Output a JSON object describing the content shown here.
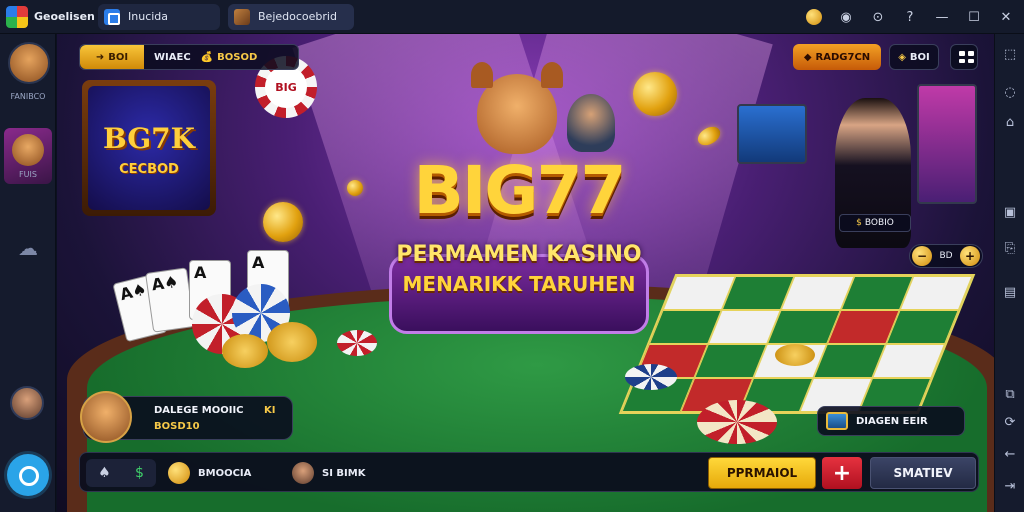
{
  "titlebar": {
    "app_title": "Geoelisen",
    "tabs": [
      {
        "label": "Inucida",
        "icon": "home-icon"
      },
      {
        "label": "Bejedocoebrid",
        "icon": "game-thumbnail-icon"
      }
    ],
    "tools": [
      "coin-icon",
      "record-icon",
      "settings-icon",
      "help-icon",
      "minimize-icon",
      "maximize-icon",
      "close-icon"
    ]
  },
  "sidebar_left": {
    "profile_label": "FANIBCO",
    "game_label": "FUIS",
    "icons": [
      "cloud-icon"
    ]
  },
  "game": {
    "balance_gold": "BOI",
    "balance_label": "WIAEC",
    "balance_value": "BOSOD",
    "top_right_value": "RADG7CN",
    "top_right_small": "BOI",
    "chip_logo_text": "BIG",
    "left_sign_title": "BG7K",
    "left_sign_sub": "CECBOD",
    "logo_title": "BIG77",
    "logo_line1": "PERMAMEN KASINO",
    "logo_line2": "MENARIKK TARUHEN",
    "dealer_tag": "BOBIO",
    "bet_pill_text": "BD",
    "player_name": "DALEGE MOOIIC",
    "player_score": "BOSD10",
    "player_level": "KI",
    "right_card_text": "DIAGEN EEIR",
    "bottom_item1": "BMOOCIA",
    "bottom_item2": "SI BIMK",
    "btn_play": "PPRMAIOL",
    "btn_plus": "+",
    "btn_start": "SMATIEV"
  },
  "colors": {
    "accent_gold": "#ffd43b",
    "accent_red": "#c22a2a",
    "felt_green": "#2f9a45",
    "bg_purple": "#4a1f74"
  }
}
